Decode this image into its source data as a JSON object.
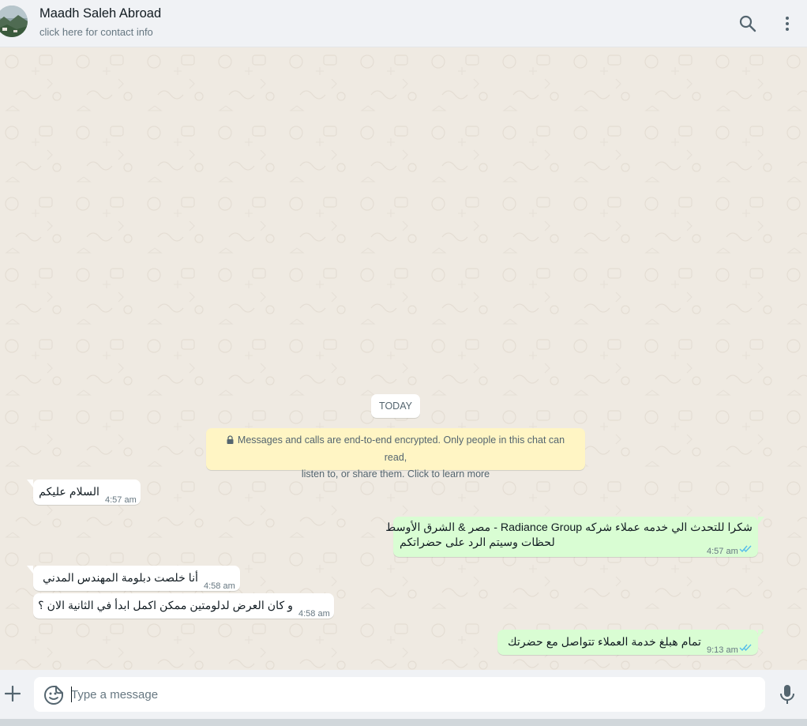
{
  "header": {
    "contact_name": "Maadh Saleh Abroad",
    "contact_subtitle": "click here for contact info",
    "icons": [
      "avatar-photo",
      "search-icon",
      "menu-icon"
    ]
  },
  "chat": {
    "date_chip": "TODAY",
    "encryption_notice": {
      "icon": "lock-icon",
      "line1": "Messages and calls are end-to-end encrypted. Only people in this chat can read,",
      "line2": "listen to, or share them. Click to learn more"
    },
    "messages": [
      {
        "direction": "incoming",
        "text": "السلام عليكم",
        "time": "4:57 am"
      },
      {
        "direction": "outgoing",
        "line1": "شكرا للتحدث الي خدمه عملاء شركه Radiance Group - مصر & الشرق الأوسط",
        "line2": "لحظات وسيتم الرد على حضراتكم",
        "time": "4:57 am",
        "status": "read"
      },
      {
        "direction": "incoming",
        "text": "أنا خلصت دبلومة المهندس المدني",
        "time": "4:58 am"
      },
      {
        "direction": "incoming",
        "text": "و كان العرض لدلومتين ممكن اكمل ابدأ في الثانية الان ؟",
        "time": "4:58 am"
      },
      {
        "direction": "outgoing",
        "text": "تمام هبلغ خدمة العملاء تتواصل مع حضرتك",
        "time": "9:13 am",
        "status": "read"
      }
    ]
  },
  "composer": {
    "placeholder": "Type a message",
    "value": "",
    "icons": [
      "plus-icon",
      "emoji-icon",
      "mic-icon"
    ]
  },
  "colors": {
    "header_bg": "#f0f2f5",
    "chat_bg": "#efeae2",
    "incoming_bubble": "#ffffff",
    "outgoing_bubble": "#d9fdd3",
    "encryption_bg": "#fff5c4",
    "read_ticks": "#53bdeb",
    "secondary_text": "#667781",
    "icon_gray": "#54656f"
  }
}
